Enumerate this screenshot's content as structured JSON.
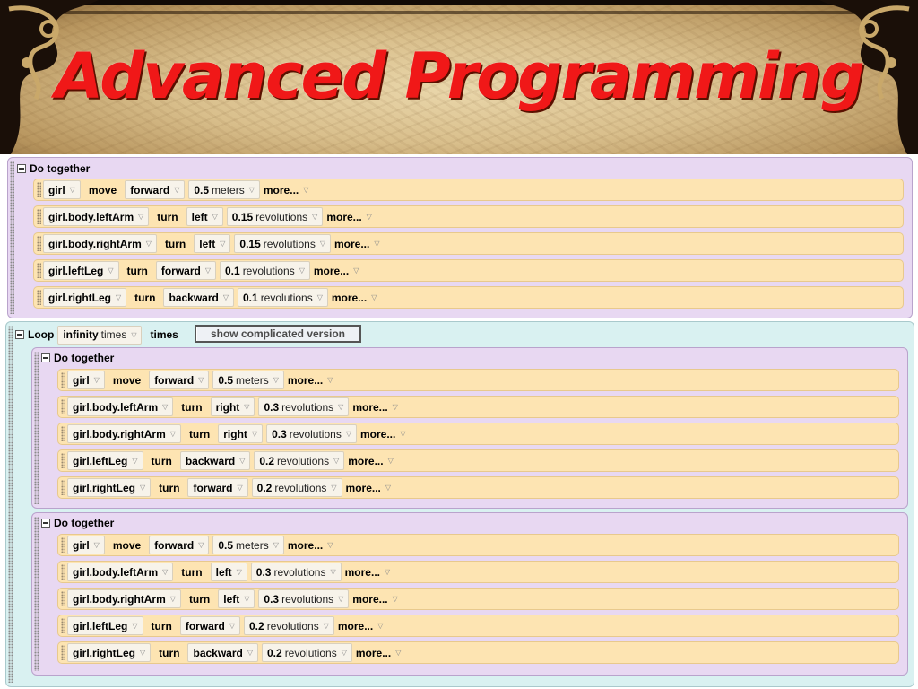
{
  "title": "Advanced Programming",
  "colors": {
    "title": "#f01818",
    "do_together_bg": "#e8d8f2",
    "loop_bg": "#d9f1f1",
    "statement_bg": "#fde4b2"
  },
  "do_together_label": "Do together",
  "more_label": "more...",
  "block1": {
    "statements": [
      {
        "object": "girl",
        "verb": "move",
        "direction": "forward",
        "amount": "0.5",
        "unit": "meters"
      },
      {
        "object": "girl.body.leftArm",
        "verb": "turn",
        "direction": "left",
        "amount": "0.15",
        "unit": "revolutions"
      },
      {
        "object": "girl.body.rightArm",
        "verb": "turn",
        "direction": "left",
        "amount": "0.15",
        "unit": "revolutions"
      },
      {
        "object": "girl.leftLeg",
        "verb": "turn",
        "direction": "forward",
        "amount": "0.1",
        "unit": "revolutions"
      },
      {
        "object": "girl.rightLeg",
        "verb": "turn",
        "direction": "backward",
        "amount": "0.1",
        "unit": "revolutions"
      }
    ]
  },
  "loop": {
    "label": "Loop",
    "count": "infinity",
    "count_unit": "times",
    "times_label": "times",
    "complicated_button": "show complicated version",
    "block2": {
      "statements": [
        {
          "object": "girl",
          "verb": "move",
          "direction": "forward",
          "amount": "0.5",
          "unit": "meters"
        },
        {
          "object": "girl.body.leftArm",
          "verb": "turn",
          "direction": "right",
          "amount": "0.3",
          "unit": "revolutions"
        },
        {
          "object": "girl.body.rightArm",
          "verb": "turn",
          "direction": "right",
          "amount": "0.3",
          "unit": "revolutions"
        },
        {
          "object": "girl.leftLeg",
          "verb": "turn",
          "direction": "backward",
          "amount": "0.2",
          "unit": "revolutions"
        },
        {
          "object": "girl.rightLeg",
          "verb": "turn",
          "direction": "forward",
          "amount": "0.2",
          "unit": "revolutions"
        }
      ]
    },
    "block3": {
      "statements": [
        {
          "object": "girl",
          "verb": "move",
          "direction": "forward",
          "amount": "0.5",
          "unit": "meters"
        },
        {
          "object": "girl.body.leftArm",
          "verb": "turn",
          "direction": "left",
          "amount": "0.3",
          "unit": "revolutions"
        },
        {
          "object": "girl.body.rightArm",
          "verb": "turn",
          "direction": "left",
          "amount": "0.3",
          "unit": "revolutions"
        },
        {
          "object": "girl.leftLeg",
          "verb": "turn",
          "direction": "forward",
          "amount": "0.2",
          "unit": "revolutions"
        },
        {
          "object": "girl.rightLeg",
          "verb": "turn",
          "direction": "backward",
          "amount": "0.2",
          "unit": "revolutions"
        }
      ]
    }
  }
}
